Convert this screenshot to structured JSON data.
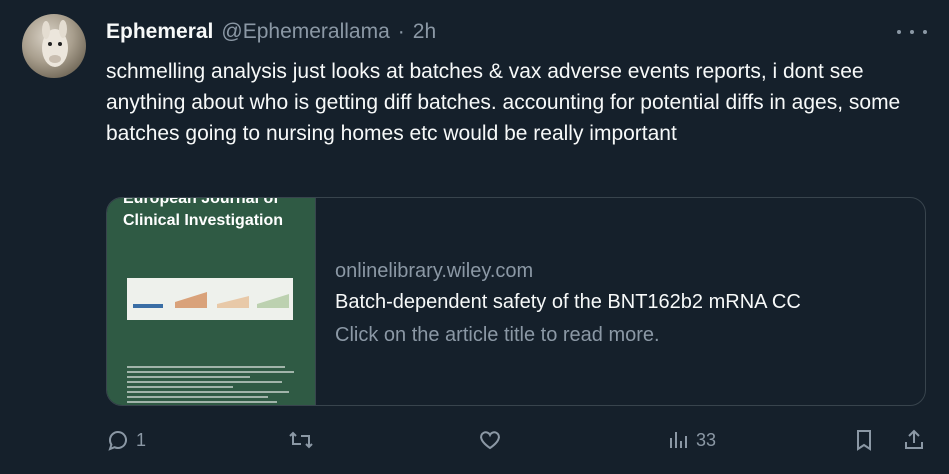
{
  "tweet": {
    "display_name": "Ephemeral",
    "handle": "@Ephemerallama",
    "separator": "·",
    "time": "2h",
    "text": "schmelling analysis just looks at batches & vax adverse events reports, i dont see anything about who is getting diff batches. accounting for potential diffs in ages, some batches going to nursing homes etc would be really important"
  },
  "card": {
    "journal_title": "European Journal of Clinical Investigation",
    "domain": "onlinelibrary.wiley.com",
    "title": "Batch-dependent safety of the BNT162b2 mRNA CC",
    "description": "Click on the article title to read more."
  },
  "actions": {
    "reply_count": "1",
    "retweet_count": "",
    "like_count": "",
    "views_count": "33"
  },
  "icons": [
    "more-icon",
    "reply-icon",
    "retweet-icon",
    "like-icon",
    "views-icon",
    "bookmark-icon",
    "share-icon"
  ],
  "colors": {
    "background": "#15202b",
    "text": "#f7f9f9",
    "muted": "#8b98a5",
    "border": "#38444d"
  }
}
